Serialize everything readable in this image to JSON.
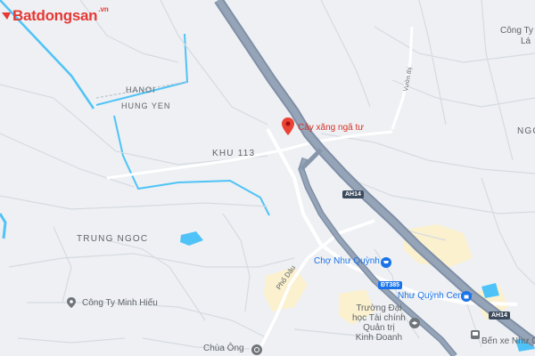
{
  "logo": {
    "text": "Batdongsan",
    "suffix": ".vn"
  },
  "provinces": {
    "north": "HANOI",
    "south": "HUNG YEN"
  },
  "areas": {
    "khu": "KHU 113",
    "trung_ngoc": "TRUNG NGOC",
    "ngo_partial": "NGO"
  },
  "pois": {
    "gas_station": "Cây xăng ngã tư",
    "cho_nhu_quynh": "Chợ Như Quỳnh",
    "nhu_quynh_center": "Như Quỳnh Center",
    "cong_ty_minh_hieu": "Công Ty Minh Hiếu",
    "truong_dai_hoc": [
      "Trường Đại",
      "học Tài chính",
      "Quản trị",
      "Kinh Doanh"
    ],
    "chua_ong": "Chùa Ông",
    "ben_xe": "Bến xe Như Q",
    "cong_ty_top": "Công Ty",
    "la_top": "Lá"
  },
  "roads": {
    "pho_dau": "Phố Dâu",
    "vuon_thi": "Vườn thị"
  },
  "shields": {
    "ah14_a": "AH14",
    "ah14_b": "AH14",
    "dt385": "ĐT385"
  },
  "colors": {
    "highway": "#8896ab",
    "water": "#4fc3f7",
    "pin": "#ea4335",
    "poi_blue": "#1a73e8"
  }
}
